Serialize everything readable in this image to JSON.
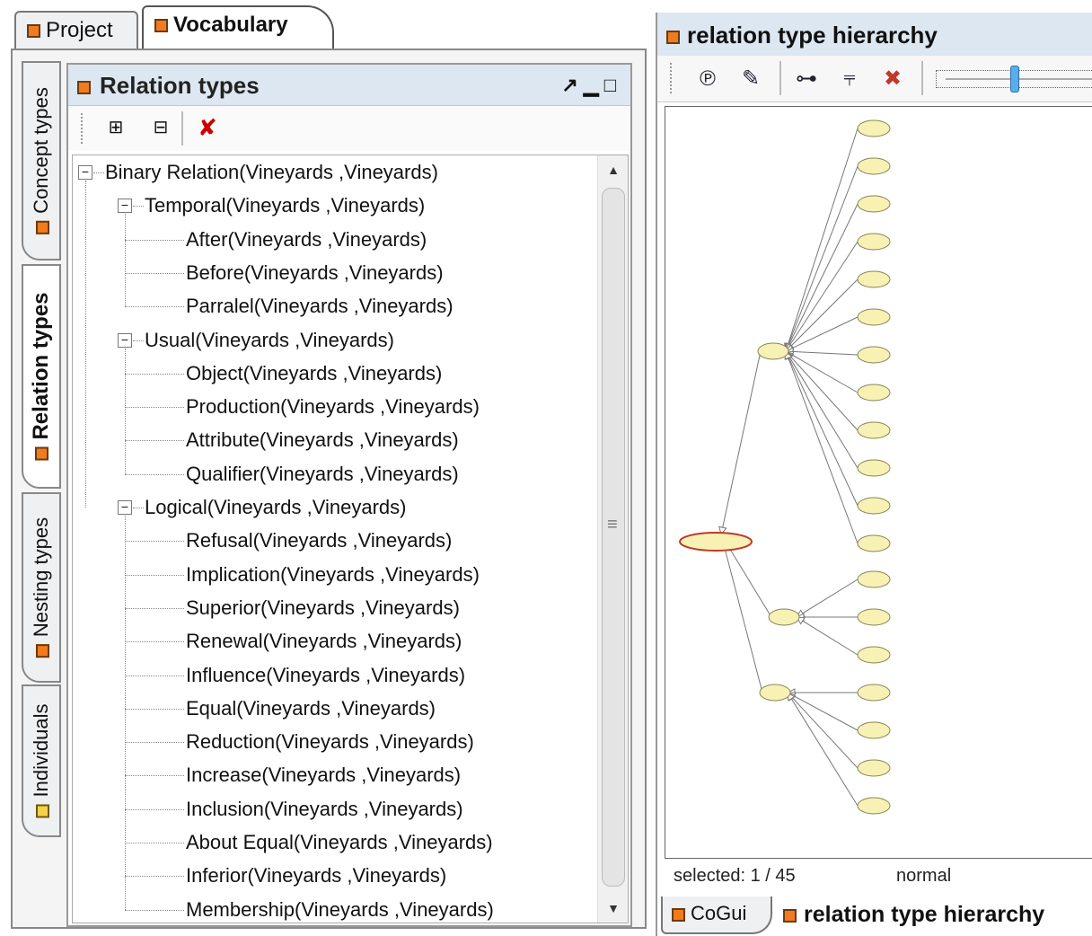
{
  "tabs": {
    "project": "Project",
    "vocabulary": "Vocabulary"
  },
  "side_tabs": {
    "concept": "Concept types",
    "relation": "Relation types",
    "nesting": "Nesting types",
    "individuals": "Individuals"
  },
  "relation_panel": {
    "title": "Relation types"
  },
  "tree": {
    "root": "Binary Relation(Vineyards ,Vineyards)",
    "groups": [
      {
        "label": "Temporal(Vineyards ,Vineyards)",
        "children": [
          "After(Vineyards ,Vineyards)",
          "Before(Vineyards ,Vineyards)",
          "Parralel(Vineyards ,Vineyards)"
        ]
      },
      {
        "label": "Usual(Vineyards ,Vineyards)",
        "children": [
          "Object(Vineyards ,Vineyards)",
          "Production(Vineyards ,Vineyards)",
          "Attribute(Vineyards ,Vineyards)",
          "Qualifier(Vineyards ,Vineyards)"
        ]
      },
      {
        "label": "Logical(Vineyards ,Vineyards)",
        "children": [
          "Refusal(Vineyards ,Vineyards)",
          "Implication(Vineyards ,Vineyards)",
          "Superior(Vineyards ,Vineyards)",
          "Renewal(Vineyards ,Vineyards)",
          "Influence(Vineyards ,Vineyards)",
          "Equal(Vineyards ,Vineyards)",
          "Reduction(Vineyards ,Vineyards)",
          "Increase(Vineyards ,Vineyards)",
          "Inclusion(Vineyards ,Vineyards)",
          "About Equal(Vineyards ,Vineyards)",
          "Inferior(Vineyards ,Vineyards)",
          "Membership(Vineyards ,Vineyards)"
        ]
      }
    ]
  },
  "hierarchy_panel": {
    "title": "relation type hierarchy",
    "status_selected": "selected: 1 / 45",
    "status_mode": "normal",
    "toolbar_icons": [
      "rt-icon",
      "edit-icon",
      "tree-layout-icon",
      "hierarchy-layout-icon",
      "delete-tag-icon"
    ],
    "node_color": "#f7f2b4",
    "selected_node_border": "#c0392b"
  },
  "bottom_tabs": {
    "cogui": "CoGui",
    "hierarchy": "relation type hierarchy"
  }
}
